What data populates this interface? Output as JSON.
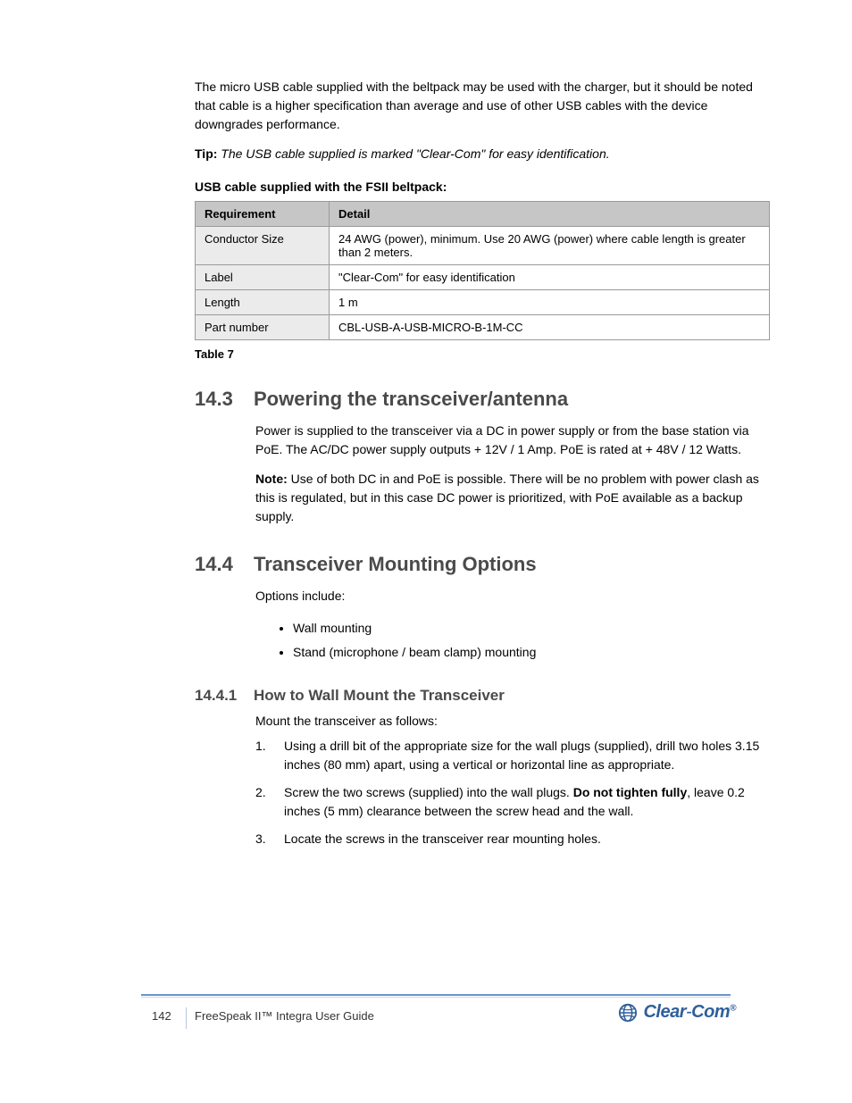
{
  "intro": {
    "p1": "The micro USB cable supplied with the beltpack may be used with the charger, but it should be noted that cable is a higher specification than average and use of other USB cables with the device downgrades performance.",
    "tip_label": "Tip:",
    "tip_text": "The USB cable supplied is marked \"Clear-Com\" for easy identification."
  },
  "table": {
    "caption": "USB cable supplied with the FSII beltpack:",
    "head_l": "Requirement",
    "head_r": "Detail",
    "rows": [
      {
        "k": "Conductor Size",
        "v": "24 AWG (power), minimum. Use 20 AWG (power) where cable length is greater than 2 meters."
      },
      {
        "k": "Label",
        "v": "\"Clear-Com\" for easy identification"
      },
      {
        "k": "Length",
        "v": "1 m"
      },
      {
        "k": "Part number",
        "v": "CBL-USB-A-USB-MICRO-B-1M-CC"
      }
    ],
    "number": "Table 7"
  },
  "section_powering": {
    "num": "14.3",
    "title": "Powering the transceiver/antenna",
    "p1": "Power is supplied to the transceiver via a DC in power supply or from the base station via PoE. The AC/DC power supply outputs + 12V / 1 Amp. PoE is rated at + 48V / 12 Watts.",
    "note_label": "Note:",
    "note_text": "Use of both DC in and PoE is possible. There will be no problem with power clash as this is regulated, but in this case DC power is prioritized, with PoE available as a backup supply."
  },
  "section_mounting": {
    "num": "14.4",
    "title": "Transceiver Mounting Options",
    "intro": "Options include:",
    "bullets": [
      "Wall mounting",
      "Stand (microphone / beam clamp) mounting"
    ]
  },
  "section_wall": {
    "num": "14.4.1",
    "title": "How to Wall Mount the Transceiver",
    "intro": "Mount the transceiver as follows:",
    "steps": [
      {
        "n": "1.",
        "t": "Using a drill bit of the appropriate size for the wall plugs (supplied), drill two holes 3.15 inches (80 mm) apart, using a vertical or horizontal line as appropriate."
      },
      {
        "n": "2.",
        "t_pre": "Screw the two screws (supplied) into the wall plugs.",
        "bold": "Do not tighten fully",
        "t_post": ", leave 0.2 inches (5 mm) clearance between the screw head and the wall."
      },
      {
        "n": "3.",
        "t": "Locate the screws in the transceiver rear mounting holes."
      }
    ]
  },
  "footer": {
    "page": "142",
    "text": "FreeSpeak II™ Integra User Guide",
    "logo": "Clear-Com"
  }
}
